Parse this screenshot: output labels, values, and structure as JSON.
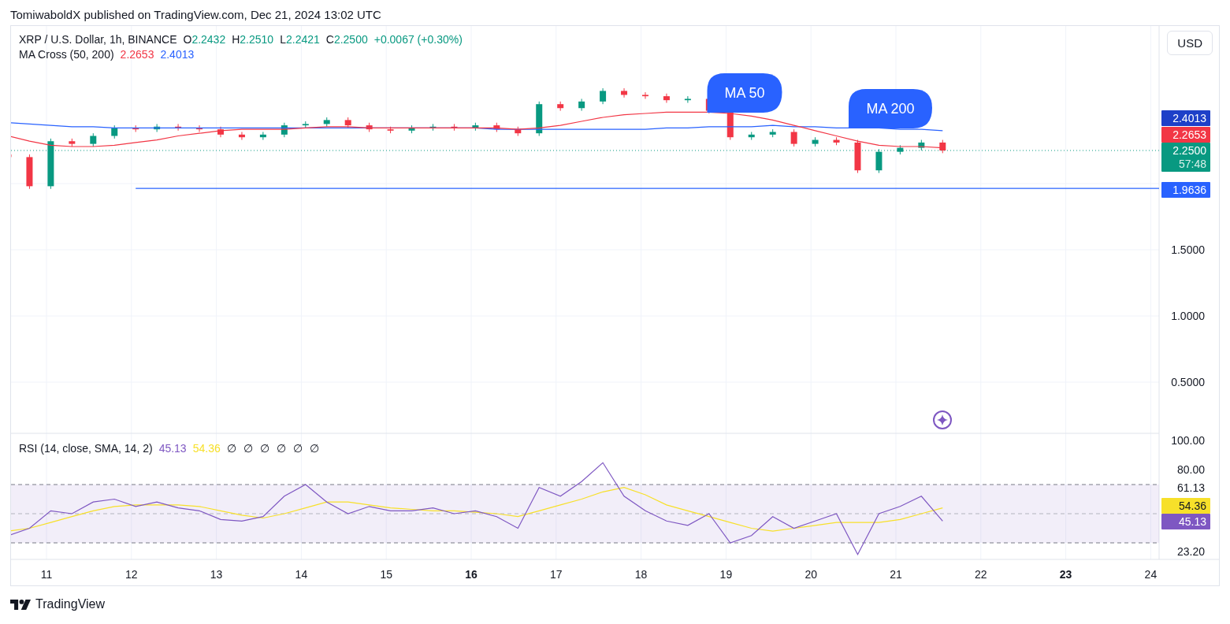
{
  "header": {
    "attribution": "TomiwaboldX published on TradingView.com, Dec 21, 2024 13:02 UTC"
  },
  "legend": {
    "symbol": "XRP / U.S. Dollar, 1h, BINANCE",
    "ohlc": [
      {
        "label": "O",
        "value": "2.2432"
      },
      {
        "label": "H",
        "value": "2.2510"
      },
      {
        "label": "L",
        "value": "2.2421"
      },
      {
        "label": "C",
        "value": "2.2500"
      }
    ],
    "change": "+0.0067 (+0.30%)",
    "indicator": {
      "name": "MA Cross (50, 200)",
      "values": [
        {
          "text": "2.2653",
          "color": "#f23645"
        },
        {
          "text": "2.4013",
          "color": "#2962ff"
        }
      ]
    }
  },
  "currency_button": "USD",
  "callouts": [
    "MA 50",
    "MA 200"
  ],
  "price_axis": {
    "labels": [
      "1.5000",
      "1.0000",
      "0.5000"
    ]
  },
  "price_tags": [
    {
      "text": "2.4013",
      "color": "#1e40c8"
    },
    {
      "text": "2.2653",
      "color": "#f23645"
    },
    {
      "text": "2.2500",
      "countdown": "57:48",
      "color": "#089981"
    },
    {
      "text": "1.9636",
      "color": "#2962ff"
    }
  ],
  "rsi": {
    "name": "RSI (14, close, SMA, 14, 2)",
    "values": [
      {
        "text": "45.13",
        "color": "#7e57c2"
      },
      {
        "text": "54.36",
        "color": "#f7e02a"
      }
    ],
    "empty_values": [
      "∅",
      "∅",
      "∅",
      "∅",
      "∅",
      "∅"
    ],
    "axis_labels": [
      "100.00",
      "80.00",
      "61.13",
      "23.20"
    ],
    "tags": [
      {
        "text": "54.36",
        "color": "#f7e02a"
      },
      {
        "text": "45.13",
        "color": "#7e57c2"
      }
    ]
  },
  "time_axis": [
    {
      "label": "11",
      "bold": false
    },
    {
      "label": "12",
      "bold": false
    },
    {
      "label": "13",
      "bold": false
    },
    {
      "label": "14",
      "bold": false
    },
    {
      "label": "15",
      "bold": false
    },
    {
      "label": "16",
      "bold": true
    },
    {
      "label": "17",
      "bold": false
    },
    {
      "label": "18",
      "bold": false
    },
    {
      "label": "19",
      "bold": false
    },
    {
      "label": "20",
      "bold": false
    },
    {
      "label": "21",
      "bold": false
    },
    {
      "label": "22",
      "bold": false
    },
    {
      "label": "23",
      "bold": true
    },
    {
      "label": "24",
      "bold": false
    }
  ],
  "footer": {
    "brand": "TradingView"
  }
}
